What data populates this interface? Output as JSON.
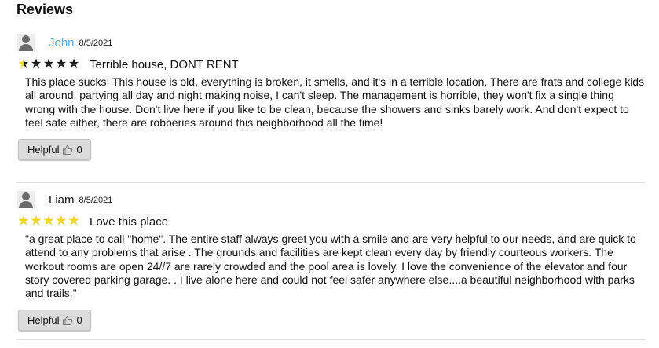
{
  "section": {
    "heading": "Reviews"
  },
  "reviews": [
    {
      "author": "John",
      "date": "8/5/2021",
      "rating": 0.5,
      "title": "Terrible house, DONT RENT",
      "body": "This place sucks! This house is old, everything is broken, it smells, and it's in a terrible location. There are frats and college kids all around, partying all day and night making noise, I can't sleep. The management is horrible, they won't fix a single thing wrong with the house. Don't live here if you like to be clean, because the showers and sinks barely work. And don't expect to feel safe either, there are robberies around this neighborhood all the time!",
      "helpful_label": "Helpful",
      "helpful_count": "0"
    },
    {
      "author": "Liam",
      "date": "8/5/2021",
      "rating": 5,
      "title": "Love this place",
      "body": "\"a great place to call \"home\". The entire staff always greet you with a smile and are very helpful to our needs, and are quick to attend to any problems that arise . The grounds and facilities are kept clean every day by friendly courteous workers. The workout rooms are open 24//7 are rarely crowded and the pool area is lovely. I love the convenience of the elevator and four story covered parking garage. . I live alone here and could not feel safer anywhere else....a beautiful neighborhood with parks and trails.\"",
      "helpful_label": "Helpful",
      "helpful_count": "0"
    }
  ],
  "colors": {
    "author_link": "#5aa7da",
    "star_gold": "#f3d417",
    "star_empty": "#1a1a1a",
    "button_bg": "#dcdcdc"
  },
  "icons": {
    "avatar": "user-silhouette-icon",
    "helpful": "thumbs-up-icon",
    "rating": "star-icon"
  }
}
